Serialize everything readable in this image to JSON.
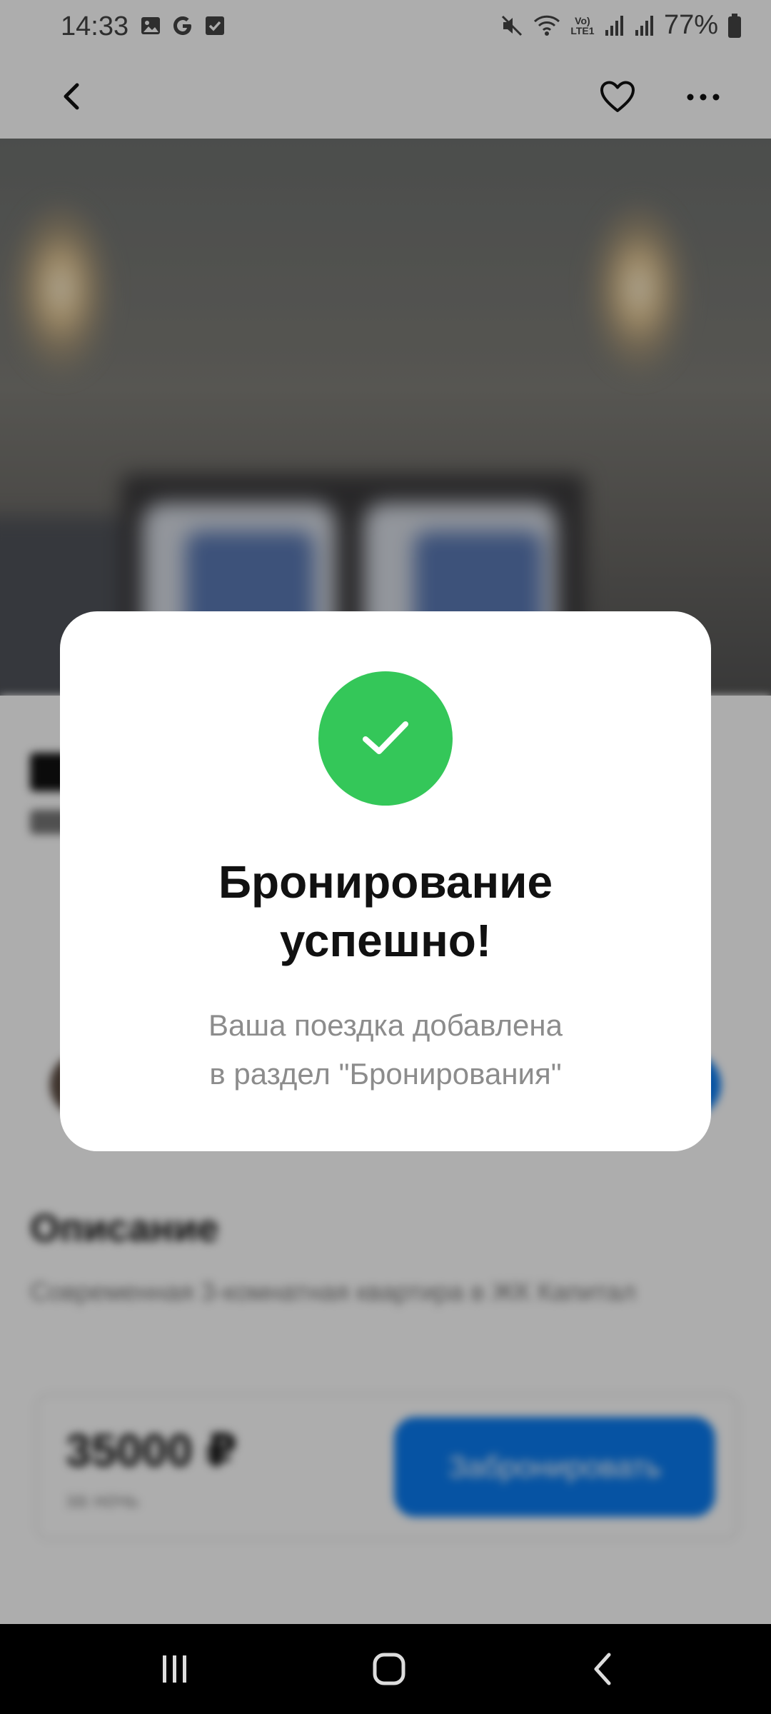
{
  "status_bar": {
    "time": "14:33",
    "battery_percent": "77%",
    "network_label": "Vo) LTE1",
    "left_icons": [
      "image-icon",
      "google-g-icon",
      "checkbox-icon"
    ],
    "right_icons": [
      "mute-icon",
      "wifi-icon",
      "signal-icon",
      "signal-icon",
      "battery-icon"
    ]
  },
  "top_bar": {
    "icons": [
      "back-arrow-icon",
      "heart-icon",
      "more-icon"
    ]
  },
  "background_page": {
    "description_title": "Описание",
    "description_text": "Современная 3-комнатная квартира в ЖК Капитал",
    "price": "35000 ₽",
    "price_period": "за ночь",
    "book_button_label": "Забронировать"
  },
  "dialog": {
    "icon": "check-icon",
    "title_line1": "Бронирование",
    "title_line2": "успешно!",
    "message_line1": "Ваша поездка добавлена",
    "message_line2": "в раздел \"Бронирования\""
  },
  "colors": {
    "success": "#34c759",
    "accent": "#0a7bf0",
    "scrim": "#000000"
  },
  "nav_bar": {
    "icons": [
      "recents-icon",
      "home-icon",
      "back-icon"
    ]
  }
}
